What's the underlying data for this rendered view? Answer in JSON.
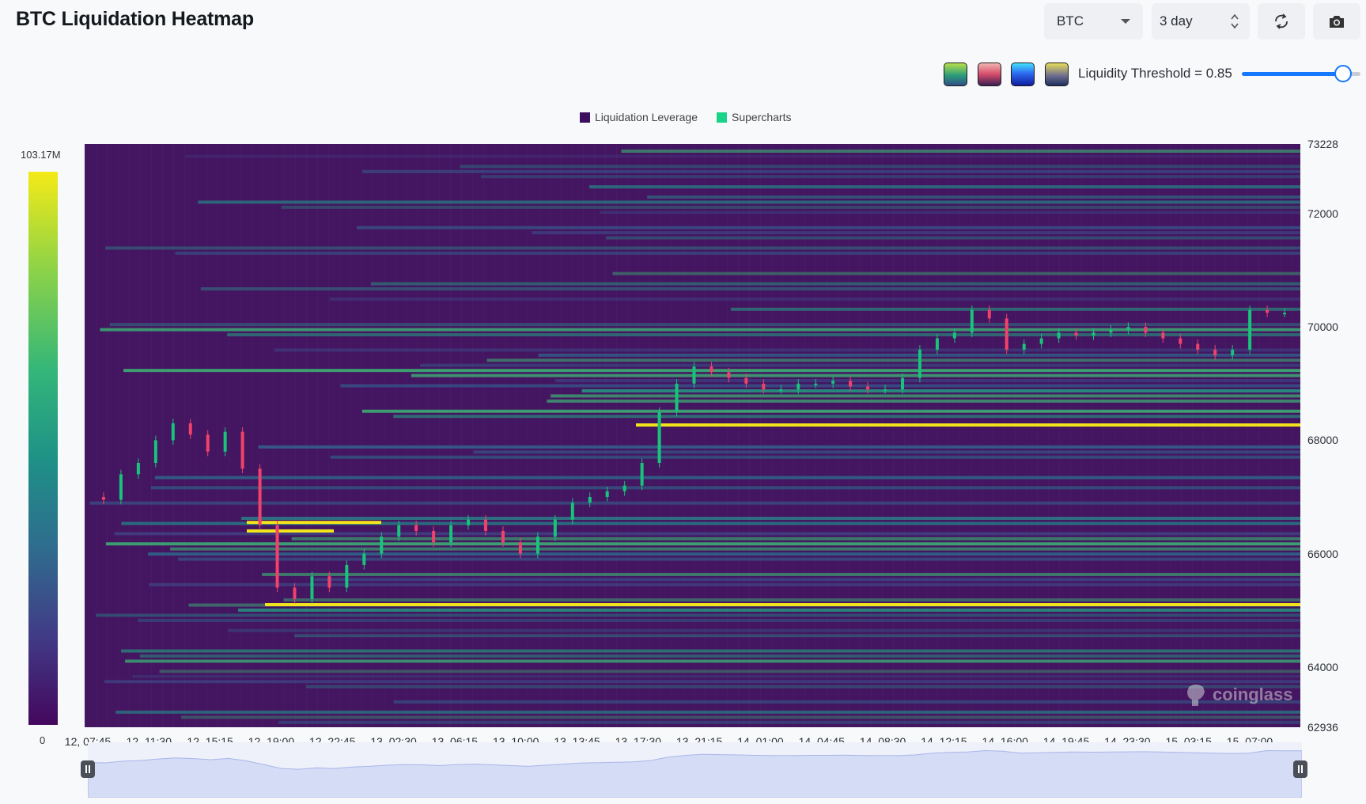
{
  "header": {
    "title": "BTC Liquidation Heatmap"
  },
  "controls": {
    "symbol_select": {
      "value": "BTC"
    },
    "range_select": {
      "value": "3 day"
    },
    "refresh_icon": "refresh-icon",
    "camera_icon": "camera-icon"
  },
  "palette": {
    "swatches": [
      {
        "name": "viridis-palette",
        "colors": [
          "#b8e04a",
          "#2a9c7b",
          "#2f4f86"
        ]
      },
      {
        "name": "magma-palette",
        "colors": [
          "#f2b6b0",
          "#d44b6b",
          "#3b2053"
        ]
      },
      {
        "name": "blue-palette",
        "colors": [
          "#43e1ff",
          "#2d6cf0",
          "#101c9e"
        ]
      },
      {
        "name": "cividis-palette",
        "colors": [
          "#e8dd5a",
          "#6f6f8f",
          "#1f2f5f"
        ]
      }
    ],
    "threshold_label": "Liquidity Threshold = 0.85",
    "threshold_value": 0.85
  },
  "legend": {
    "items": [
      "Liquidation Leverage",
      "Supercharts"
    ]
  },
  "color_scale": {
    "max_label": "103.17M",
    "min_label": "0"
  },
  "chart_data": {
    "type": "heatmap",
    "y_axis": {
      "min": 62936,
      "max": 73228,
      "ticks": [
        "73228",
        "72000",
        "70000",
        "68000",
        "66000",
        "64000",
        "62936"
      ]
    },
    "x_axis": {
      "ticks": [
        "12, 07:45",
        "12, 11:30",
        "12, 15:15",
        "12, 19:00",
        "12, 22:45",
        "13, 02:30",
        "13, 06:15",
        "13, 10:00",
        "13, 13:45",
        "13, 17:30",
        "13, 21:15",
        "14, 01:00",
        "14, 04:45",
        "14, 08:30",
        "14, 12:15",
        "14, 16:00",
        "14, 19:45",
        "14, 23:30",
        "15, 03:15",
        "15, 07:00"
      ]
    },
    "price_series": [
      67000,
      66950,
      67400,
      67600,
      68000,
      68300,
      68100,
      67800,
      68150,
      67500,
      66500,
      65400,
      65200,
      65600,
      65400,
      65800,
      66000,
      66300,
      66500,
      66400,
      66200,
      66500,
      66600,
      66400,
      66200,
      66000,
      66300,
      66600,
      66900,
      67000,
      67100,
      67200,
      67600,
      68500,
      69000,
      69300,
      69200,
      69100,
      69000,
      68900,
      68900,
      69000,
      69000,
      69050,
      68950,
      68900,
      68900,
      69100,
      69600,
      69800,
      69900,
      70300,
      70150,
      69600,
      69700,
      69800,
      69900,
      69850,
      69900,
      69950,
      70000,
      69900,
      69800,
      69700,
      69600,
      69500,
      69600,
      70300,
      70250,
      70250
    ],
    "liquidity_levels": [
      {
        "price": 68270,
        "intensity": 1.0
      },
      {
        "price": 65100,
        "intensity": 1.0
      },
      {
        "price": 66550,
        "intensity": 0.95
      },
      {
        "price": 66400,
        "intensity": 0.9
      }
    ],
    "color_range": {
      "min": 0,
      "max": "103.17M"
    }
  },
  "watermark": {
    "text": "coinglass"
  }
}
